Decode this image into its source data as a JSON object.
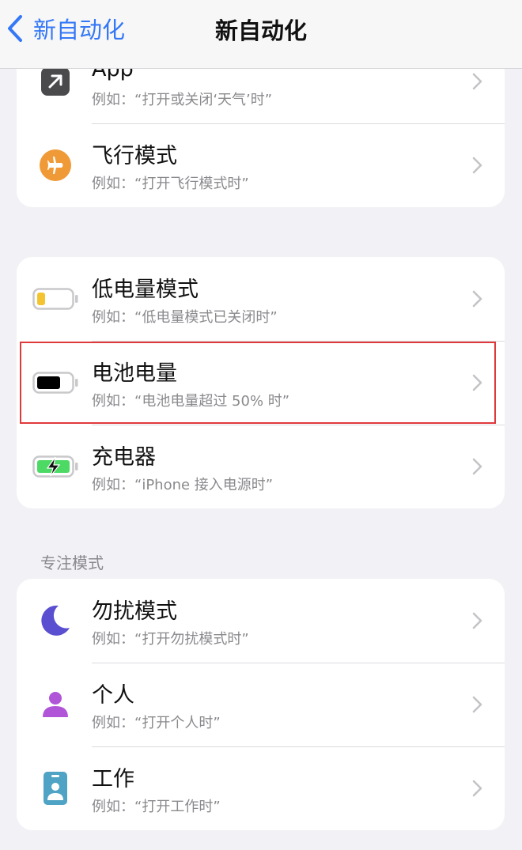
{
  "nav": {
    "back_label": "新自动化",
    "title": "新自动化"
  },
  "group1": {
    "items": [
      {
        "title": "App",
        "subtitle": "例如：“打开或关闭‘天气’时”",
        "icon": "app-arrow-icon"
      },
      {
        "title": "飞行模式",
        "subtitle": "例如：“打开飞行模式时”",
        "icon": "airplane-icon"
      }
    ]
  },
  "group2": {
    "items": [
      {
        "title": "低电量模式",
        "subtitle": "例如：“低电量模式已关闭时”",
        "icon": "low-battery-icon"
      },
      {
        "title": "电池电量",
        "subtitle": "例如：“电池电量超过 50% 时”",
        "icon": "battery-icon"
      },
      {
        "title": "充电器",
        "subtitle": "例如：“iPhone 接入电源时”",
        "icon": "charging-battery-icon"
      }
    ]
  },
  "focus_section": {
    "header": "专注模式",
    "items": [
      {
        "title": "勿扰模式",
        "subtitle": "例如：“打开勿扰模式时”",
        "icon": "moon-icon"
      },
      {
        "title": "个人",
        "subtitle": "例如：“打开个人时”",
        "icon": "person-icon"
      },
      {
        "title": "工作",
        "subtitle": "例如：“打开工作时”",
        "icon": "work-badge-icon"
      }
    ]
  },
  "colors": {
    "accent": "#3478f6",
    "background": "#f2f2f6",
    "highlight": "#e0393c",
    "airplane": "#f09a37",
    "moon": "#5a4fd1",
    "person": "#b155d8",
    "work": "#4fa3c4",
    "low_battery": "#f4c430",
    "charging": "#4cd964"
  }
}
